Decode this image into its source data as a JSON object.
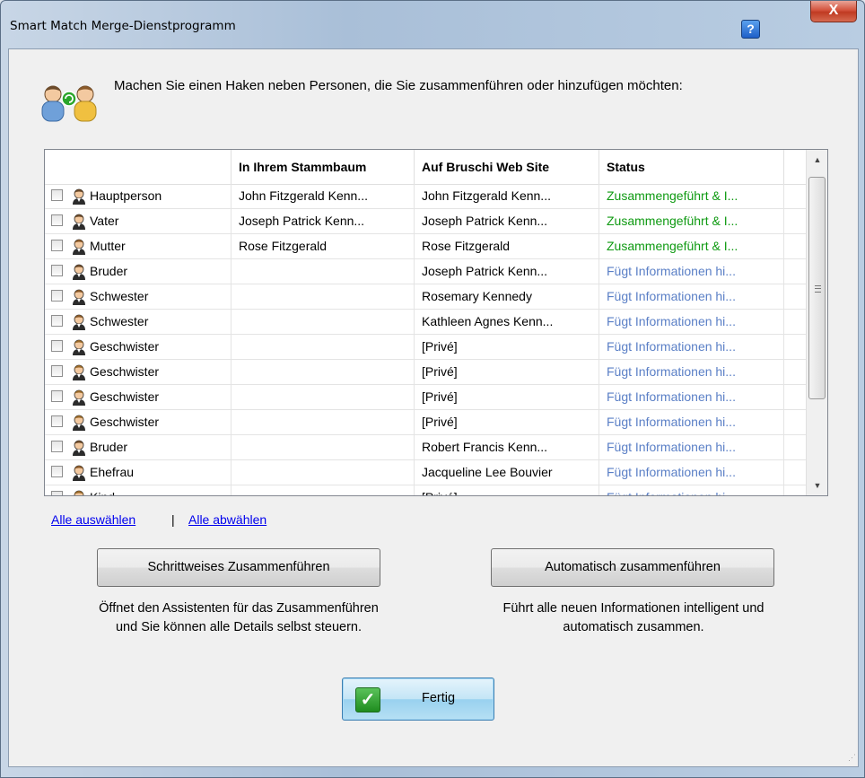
{
  "window": {
    "title": "Smart Match Merge-Dienstprogramm",
    "help_label": "?",
    "close_label": "X"
  },
  "instruction": "Machen Sie einen Haken neben Personen, die Sie zusammenführen oder hinzufügen möchten:",
  "table": {
    "columns": [
      "",
      "In Ihrem Stammbaum",
      "Auf Bruschi Web Site",
      "Status"
    ],
    "rows": [
      {
        "relation": "Hauptperson",
        "tree": "John Fitzgerald Kenn...",
        "site": "John Fitzgerald Kenn...",
        "status": "Zusammengeführt & I...",
        "status_type": "merged",
        "gender": "male"
      },
      {
        "relation": "Vater",
        "tree": "Joseph Patrick Kenn...",
        "site": "Joseph Patrick Kenn...",
        "status": "Zusammengeführt & I...",
        "status_type": "merged",
        "gender": "male"
      },
      {
        "relation": "Mutter",
        "tree": "Rose Fitzgerald",
        "site": "Rose Fitzgerald",
        "status": "Zusammengeführt & I...",
        "status_type": "merged",
        "gender": "female"
      },
      {
        "relation": "Bruder",
        "tree": "",
        "site": "Joseph Patrick Kenn...",
        "status": "Fügt Informationen hi...",
        "status_type": "adding",
        "gender": "male"
      },
      {
        "relation": "Schwester",
        "tree": "",
        "site": "Rosemary Kennedy",
        "status": "Fügt Informationen hi...",
        "status_type": "adding",
        "gender": "female"
      },
      {
        "relation": "Schwester",
        "tree": "",
        "site": "Kathleen Agnes Kenn...",
        "status": "Fügt Informationen hi...",
        "status_type": "adding",
        "gender": "female"
      },
      {
        "relation": "Geschwister",
        "tree": "",
        "site": "[Privé]",
        "status": "Fügt Informationen hi...",
        "status_type": "adding",
        "gender": "unknown"
      },
      {
        "relation": "Geschwister",
        "tree": "",
        "site": "[Privé]",
        "status": "Fügt Informationen hi...",
        "status_type": "adding",
        "gender": "unknown"
      },
      {
        "relation": "Geschwister",
        "tree": "",
        "site": "[Privé]",
        "status": "Fügt Informationen hi...",
        "status_type": "adding",
        "gender": "unknown"
      },
      {
        "relation": "Geschwister",
        "tree": "",
        "site": "[Privé]",
        "status": "Fügt Informationen hi...",
        "status_type": "adding",
        "gender": "unknown"
      },
      {
        "relation": "Bruder",
        "tree": "",
        "site": "Robert Francis Kenn...",
        "status": "Fügt Informationen hi...",
        "status_type": "adding",
        "gender": "male"
      },
      {
        "relation": "Ehefrau",
        "tree": "",
        "site": "Jacqueline Lee Bouvier",
        "status": "Fügt Informationen hi...",
        "status_type": "adding",
        "gender": "female"
      },
      {
        "relation": "Kind",
        "tree": "",
        "site": "[Privé]",
        "status": "Fügt Informationen hi...",
        "status_type": "adding",
        "gender": "unknown"
      }
    ]
  },
  "links": {
    "select_all": "Alle auswählen",
    "separator": "|",
    "deselect_all": "Alle abwählen"
  },
  "step_merge": {
    "label": "Schrittweises Zusammenführen",
    "desc_line1": "Öffnet den Assistenten für das Zusammenführen",
    "desc_line2": "und Sie können alle Details selbst steuern."
  },
  "auto_merge": {
    "label": "Automatisch zusammenführen",
    "desc_line1": "Führt alle neuen Informationen intelligent und",
    "desc_line2": "automatisch zusammen."
  },
  "done_button": {
    "label": "Fertig",
    "icon": "checkmark-icon"
  },
  "colors": {
    "merged": "#0f9a12",
    "adding": "#5a7fc6",
    "link": "#0000ee"
  }
}
